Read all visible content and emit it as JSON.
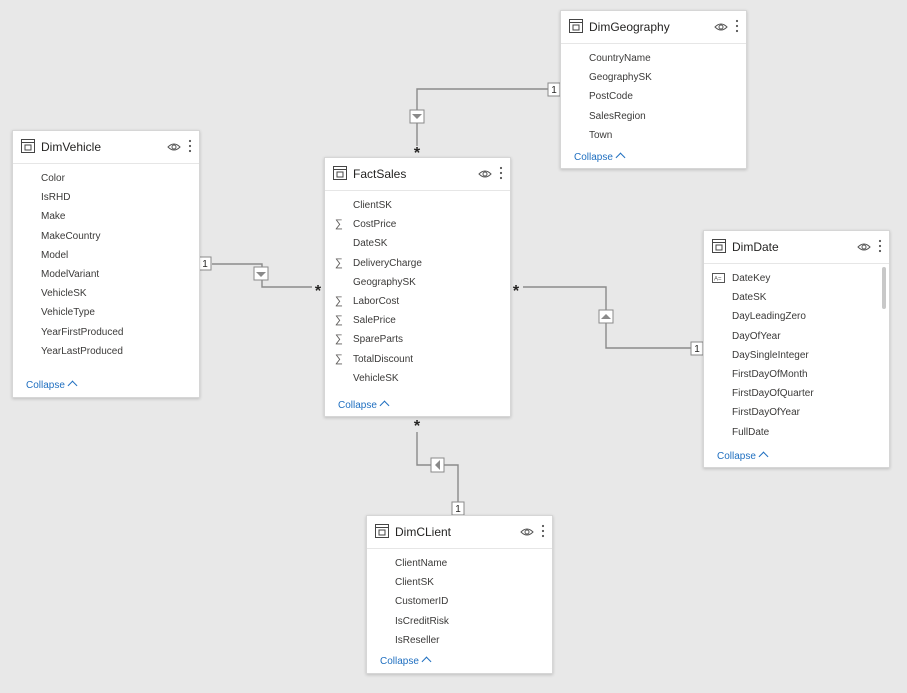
{
  "tables": [
    {
      "id": "dimvehicle",
      "title": "DimVehicle",
      "fields": [
        {
          "name": "Color",
          "type": "plain"
        },
        {
          "name": "IsRHD",
          "type": "plain"
        },
        {
          "name": "Make",
          "type": "plain"
        },
        {
          "name": "MakeCountry",
          "type": "plain"
        },
        {
          "name": "Model",
          "type": "plain"
        },
        {
          "name": "ModelVariant",
          "type": "plain"
        },
        {
          "name": "VehicleSK",
          "type": "plain"
        },
        {
          "name": "VehicleType",
          "type": "plain"
        },
        {
          "name": "YearFirstProduced",
          "type": "plain"
        },
        {
          "name": "YearLastProduced",
          "type": "plain"
        }
      ],
      "collapse_label": "Collapse"
    },
    {
      "id": "factsales",
      "title": "FactSales",
      "fields": [
        {
          "name": "ClientSK",
          "type": "plain"
        },
        {
          "name": "CostPrice",
          "type": "sigma"
        },
        {
          "name": "DateSK",
          "type": "plain"
        },
        {
          "name": "DeliveryCharge",
          "type": "sigma"
        },
        {
          "name": "GeographySK",
          "type": "plain"
        },
        {
          "name": "LaborCost",
          "type": "sigma"
        },
        {
          "name": "SalePrice",
          "type": "sigma"
        },
        {
          "name": "SpareParts",
          "type": "sigma"
        },
        {
          "name": "TotalDiscount",
          "type": "sigma"
        },
        {
          "name": "VehicleSK",
          "type": "plain"
        }
      ],
      "collapse_label": "Collapse"
    },
    {
      "id": "dimgeography",
      "title": "DimGeography",
      "fields": [
        {
          "name": "CountryName",
          "type": "plain"
        },
        {
          "name": "GeographySK",
          "type": "plain"
        },
        {
          "name": "PostCode",
          "type": "plain"
        },
        {
          "name": "SalesRegion",
          "type": "plain"
        },
        {
          "name": "Town",
          "type": "plain"
        }
      ],
      "collapse_label": "Collapse"
    },
    {
      "id": "dimdate",
      "title": "DimDate",
      "fields": [
        {
          "name": "DateKey",
          "type": "text"
        },
        {
          "name": "DateSK",
          "type": "plain"
        },
        {
          "name": "DayLeadingZero",
          "type": "plain"
        },
        {
          "name": "DayOfYear",
          "type": "plain"
        },
        {
          "name": "DaySingleInteger",
          "type": "plain"
        },
        {
          "name": "FirstDayOfMonth",
          "type": "plain"
        },
        {
          "name": "FirstDayOfQuarter",
          "type": "plain"
        },
        {
          "name": "FirstDayOfYear",
          "type": "plain"
        },
        {
          "name": "FullDate",
          "type": "plain"
        }
      ],
      "collapse_label": "Collapse"
    },
    {
      "id": "dimclient",
      "title": "DimCLient",
      "fields": [
        {
          "name": "ClientName",
          "type": "plain"
        },
        {
          "name": "ClientSK",
          "type": "plain"
        },
        {
          "name": "CustomerID",
          "type": "plain"
        },
        {
          "name": "IsCreditRisk",
          "type": "plain"
        },
        {
          "name": "IsReseller",
          "type": "plain"
        }
      ],
      "collapse_label": "Collapse"
    }
  ],
  "relationships": [
    {
      "one_label": "1",
      "many_label": "*",
      "from": "DimVehicle",
      "to": "FactSales"
    },
    {
      "one_label": "1",
      "many_label": "*",
      "from": "DimGeography",
      "to": "FactSales"
    },
    {
      "one_label": "1",
      "many_label": "*",
      "from": "DimDate",
      "to": "FactSales"
    },
    {
      "one_label": "1",
      "many_label": "*",
      "from": "DimCLient",
      "to": "FactSales"
    }
  ],
  "colors": {
    "canvas": "#e8e8e8",
    "card": "#ffffff",
    "link": "#1f6fc0",
    "line": "#8a8a8a"
  },
  "icons": {
    "table": "table-icon",
    "visibility": "eye-icon",
    "more": "more-options-icon",
    "sum": "sigma-icon",
    "text": "text-field-icon"
  }
}
